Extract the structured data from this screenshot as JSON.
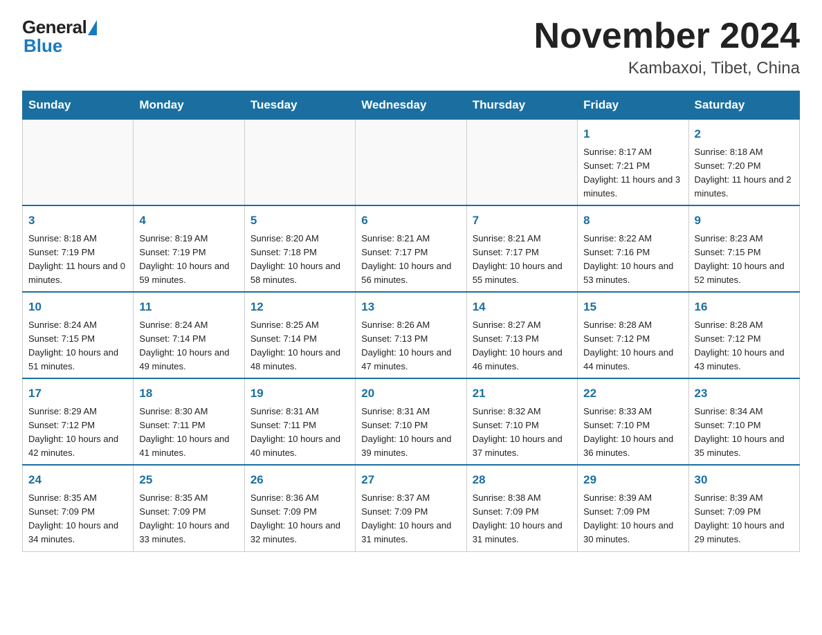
{
  "header": {
    "logo_text_general": "General",
    "logo_text_blue": "Blue",
    "title": "November 2024",
    "location": "Kambaxoi, Tibet, China"
  },
  "weekdays": [
    "Sunday",
    "Monday",
    "Tuesday",
    "Wednesday",
    "Thursday",
    "Friday",
    "Saturday"
  ],
  "weeks": [
    [
      {
        "day": "",
        "info": ""
      },
      {
        "day": "",
        "info": ""
      },
      {
        "day": "",
        "info": ""
      },
      {
        "day": "",
        "info": ""
      },
      {
        "day": "",
        "info": ""
      },
      {
        "day": "1",
        "info": "Sunrise: 8:17 AM\nSunset: 7:21 PM\nDaylight: 11 hours and 3 minutes."
      },
      {
        "day": "2",
        "info": "Sunrise: 8:18 AM\nSunset: 7:20 PM\nDaylight: 11 hours and 2 minutes."
      }
    ],
    [
      {
        "day": "3",
        "info": "Sunrise: 8:18 AM\nSunset: 7:19 PM\nDaylight: 11 hours and 0 minutes."
      },
      {
        "day": "4",
        "info": "Sunrise: 8:19 AM\nSunset: 7:19 PM\nDaylight: 10 hours and 59 minutes."
      },
      {
        "day": "5",
        "info": "Sunrise: 8:20 AM\nSunset: 7:18 PM\nDaylight: 10 hours and 58 minutes."
      },
      {
        "day": "6",
        "info": "Sunrise: 8:21 AM\nSunset: 7:17 PM\nDaylight: 10 hours and 56 minutes."
      },
      {
        "day": "7",
        "info": "Sunrise: 8:21 AM\nSunset: 7:17 PM\nDaylight: 10 hours and 55 minutes."
      },
      {
        "day": "8",
        "info": "Sunrise: 8:22 AM\nSunset: 7:16 PM\nDaylight: 10 hours and 53 minutes."
      },
      {
        "day": "9",
        "info": "Sunrise: 8:23 AM\nSunset: 7:15 PM\nDaylight: 10 hours and 52 minutes."
      }
    ],
    [
      {
        "day": "10",
        "info": "Sunrise: 8:24 AM\nSunset: 7:15 PM\nDaylight: 10 hours and 51 minutes."
      },
      {
        "day": "11",
        "info": "Sunrise: 8:24 AM\nSunset: 7:14 PM\nDaylight: 10 hours and 49 minutes."
      },
      {
        "day": "12",
        "info": "Sunrise: 8:25 AM\nSunset: 7:14 PM\nDaylight: 10 hours and 48 minutes."
      },
      {
        "day": "13",
        "info": "Sunrise: 8:26 AM\nSunset: 7:13 PM\nDaylight: 10 hours and 47 minutes."
      },
      {
        "day": "14",
        "info": "Sunrise: 8:27 AM\nSunset: 7:13 PM\nDaylight: 10 hours and 46 minutes."
      },
      {
        "day": "15",
        "info": "Sunrise: 8:28 AM\nSunset: 7:12 PM\nDaylight: 10 hours and 44 minutes."
      },
      {
        "day": "16",
        "info": "Sunrise: 8:28 AM\nSunset: 7:12 PM\nDaylight: 10 hours and 43 minutes."
      }
    ],
    [
      {
        "day": "17",
        "info": "Sunrise: 8:29 AM\nSunset: 7:12 PM\nDaylight: 10 hours and 42 minutes."
      },
      {
        "day": "18",
        "info": "Sunrise: 8:30 AM\nSunset: 7:11 PM\nDaylight: 10 hours and 41 minutes."
      },
      {
        "day": "19",
        "info": "Sunrise: 8:31 AM\nSunset: 7:11 PM\nDaylight: 10 hours and 40 minutes."
      },
      {
        "day": "20",
        "info": "Sunrise: 8:31 AM\nSunset: 7:10 PM\nDaylight: 10 hours and 39 minutes."
      },
      {
        "day": "21",
        "info": "Sunrise: 8:32 AM\nSunset: 7:10 PM\nDaylight: 10 hours and 37 minutes."
      },
      {
        "day": "22",
        "info": "Sunrise: 8:33 AM\nSunset: 7:10 PM\nDaylight: 10 hours and 36 minutes."
      },
      {
        "day": "23",
        "info": "Sunrise: 8:34 AM\nSunset: 7:10 PM\nDaylight: 10 hours and 35 minutes."
      }
    ],
    [
      {
        "day": "24",
        "info": "Sunrise: 8:35 AM\nSunset: 7:09 PM\nDaylight: 10 hours and 34 minutes."
      },
      {
        "day": "25",
        "info": "Sunrise: 8:35 AM\nSunset: 7:09 PM\nDaylight: 10 hours and 33 minutes."
      },
      {
        "day": "26",
        "info": "Sunrise: 8:36 AM\nSunset: 7:09 PM\nDaylight: 10 hours and 32 minutes."
      },
      {
        "day": "27",
        "info": "Sunrise: 8:37 AM\nSunset: 7:09 PM\nDaylight: 10 hours and 31 minutes."
      },
      {
        "day": "28",
        "info": "Sunrise: 8:38 AM\nSunset: 7:09 PM\nDaylight: 10 hours and 31 minutes."
      },
      {
        "day": "29",
        "info": "Sunrise: 8:39 AM\nSunset: 7:09 PM\nDaylight: 10 hours and 30 minutes."
      },
      {
        "day": "30",
        "info": "Sunrise: 8:39 AM\nSunset: 7:09 PM\nDaylight: 10 hours and 29 minutes."
      }
    ]
  ]
}
